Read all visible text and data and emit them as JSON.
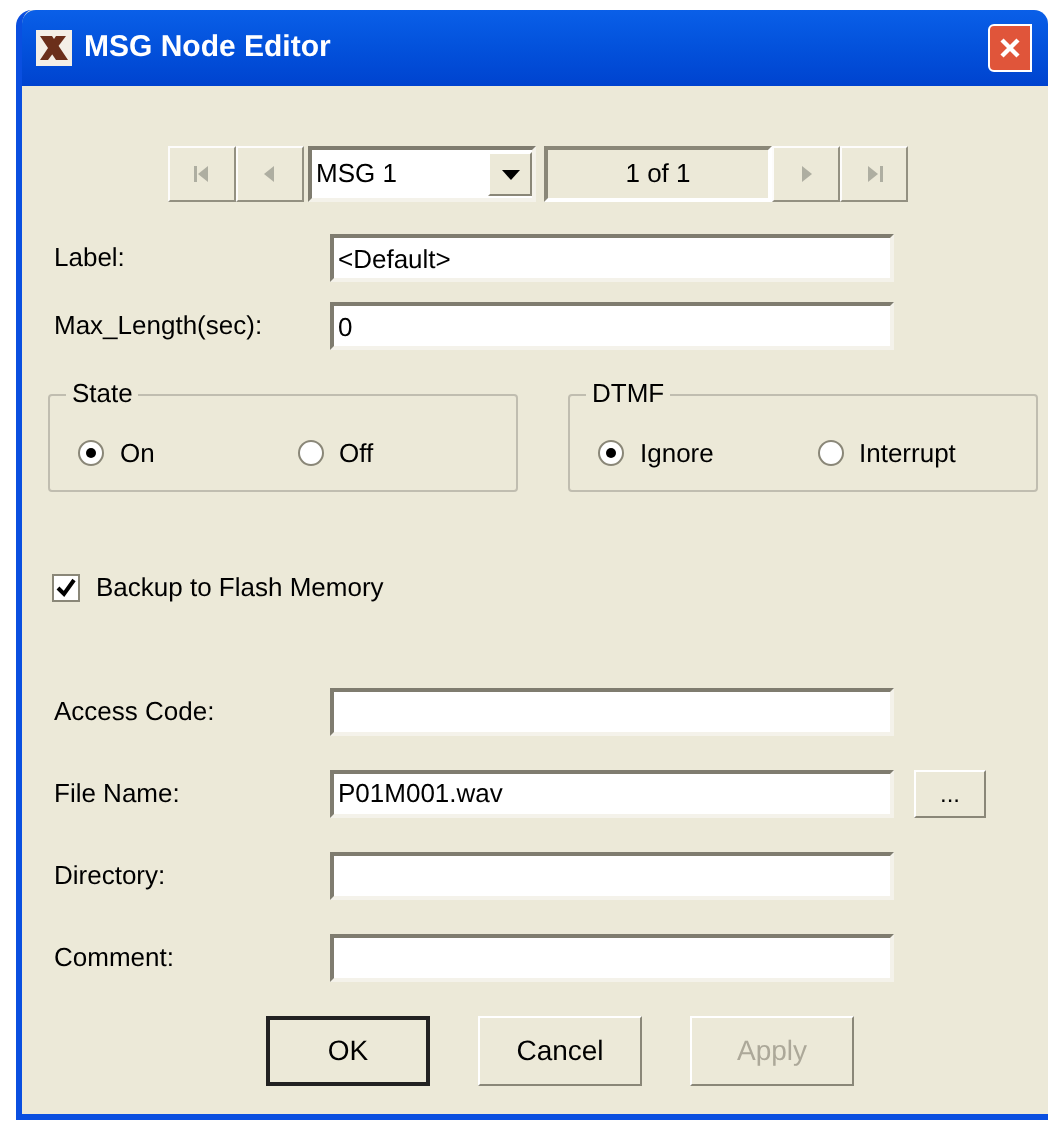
{
  "window": {
    "title": "MSG Node Editor"
  },
  "navigator": {
    "buttons": [
      {
        "kind": "first",
        "disabled": true
      },
      {
        "kind": "prev",
        "disabled": true
      },
      {
        "kind": "next",
        "disabled": true
      },
      {
        "kind": "last",
        "disabled": true
      }
    ],
    "record": "MSG 1",
    "position": "1 of 1"
  },
  "top_fields": [
    {
      "label": "Label:",
      "value": "<Default>"
    },
    {
      "label": "Max_Length(sec):",
      "value": "0"
    }
  ],
  "groups": [
    {
      "title": "State",
      "options": [
        {
          "label": "On",
          "selected": true
        },
        {
          "label": "Off",
          "selected": false
        }
      ]
    },
    {
      "title": "DTMF",
      "options": [
        {
          "label": "Ignore",
          "selected": true
        },
        {
          "label": "Interrupt",
          "selected": false
        }
      ]
    }
  ],
  "backup": {
    "label": "Backup to Flash Memory",
    "checked": true
  },
  "fields": [
    {
      "label": "Access Code:"
    },
    {
      "label": "File Name:",
      "value": "P01M001.wav",
      "browse": "..."
    },
    {
      "label": "Directory:"
    },
    {
      "label": "Comment:"
    }
  ],
  "buttons": [
    {
      "label": "OK",
      "default": true,
      "disabled": false
    },
    {
      "label": "Cancel",
      "default": false,
      "disabled": false
    },
    {
      "label": "Apply",
      "default": false,
      "disabled": true
    }
  ]
}
